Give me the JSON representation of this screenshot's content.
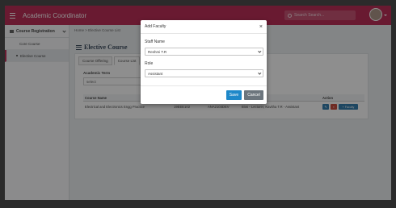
{
  "app": {
    "title": "Academic Coordinator"
  },
  "search": {
    "placeholder": "Search Search..."
  },
  "sidebar": {
    "group_label": "Course Registration",
    "items": [
      {
        "label": "Core Course"
      },
      {
        "label": "Elective Course"
      }
    ]
  },
  "breadcrumb": "Home > Elective Course List",
  "page": {
    "title": "Elective Course"
  },
  "tabs": [
    {
      "label": "Course Offering"
    },
    {
      "label": "Course List"
    }
  ],
  "filter": {
    "label": "Academic Term",
    "value": "select"
  },
  "table": {
    "headers": [
      "Course Name",
      "",
      "",
      "",
      "Action"
    ],
    "rows": [
      {
        "name": "Electrical and Electronics Engg Practice",
        "code": "19EEE102",
        "id": "ANA2103DEV",
        "faculty": "Bios - Lecturer, Kavitha T.R - Assistant"
      }
    ],
    "faculty_button": "+ Faculty"
  },
  "modal": {
    "title": "Add Faculty",
    "close": "×",
    "staff_label": "Staff Name",
    "staff_value": "Reshmi T.R",
    "role_label": "Role",
    "role_value": "Assistant",
    "save": "Save",
    "cancel": "Cancel"
  },
  "colors": {
    "topbar": "#b51744",
    "primary": "#1e88c9",
    "secondary": "#6c757d",
    "danger": "#c0392b"
  }
}
